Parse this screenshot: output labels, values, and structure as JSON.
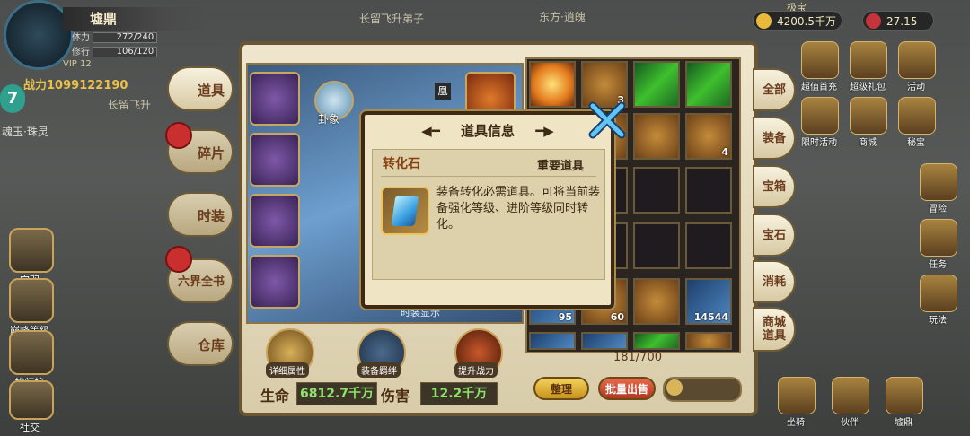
{
  "player": {
    "name": "墟鼎",
    "stat1_label": "体力",
    "stat1_value": "272/240",
    "stat2_label": "修行",
    "stat2_value": "106/120",
    "vip": "VIP 12",
    "power_label": "战力",
    "power_value": "1099122190",
    "badge": "7"
  },
  "resources": {
    "gold": "4200.5千万",
    "gems": "27.15"
  },
  "left_menu": [
    {
      "label": "宫羽"
    },
    {
      "label": "巅峰等级"
    },
    {
      "label": "排行榜"
    },
    {
      "label": "社交"
    }
  ],
  "background_text": {
    "top_center_1": "长留飞升弟子",
    "top_center_2": "东方·逍魄",
    "left_place": "长留飞升",
    "left_sub": "魂玉·珠灵",
    "right_top": "极宝"
  },
  "bag_tabs": [
    {
      "label": "道具"
    },
    {
      "label": "碎片"
    },
    {
      "label": "时装"
    },
    {
      "label": "六界全书"
    },
    {
      "label": "仓库"
    }
  ],
  "character": {
    "gua_label": "卦象",
    "fashion_text": "时装显示",
    "phoenix_label": "凰"
  },
  "bottom_buttons": [
    {
      "label": "详细属性"
    },
    {
      "label": "装备羁绊"
    },
    {
      "label": "提升战力"
    }
  ],
  "stats": {
    "hp_label": "生命",
    "hp_value": "6812.7千万",
    "atk_label": "伤害",
    "atk_value": "12.2千万"
  },
  "bag": {
    "counts": {
      "slot1": "3",
      "slot2": "4",
      "slot3": "95",
      "slot4": "60",
      "slot5": "14544"
    },
    "capacity": "181/700",
    "sort_button": "整理",
    "sell_button": "批量出售"
  },
  "categories": [
    {
      "label": "全部"
    },
    {
      "label": "装备"
    },
    {
      "label": "宝箱"
    },
    {
      "label": "宝石"
    },
    {
      "label": "消耗"
    },
    {
      "label": "商城道具"
    }
  ],
  "right_icons": [
    {
      "label": "超值首充"
    },
    {
      "label": "超级礼包"
    },
    {
      "label": "活动"
    },
    {
      "label": "限时活动"
    },
    {
      "label": "商城"
    },
    {
      "label": "秘宝"
    },
    {
      "label": "冒险"
    },
    {
      "label": "任务"
    },
    {
      "label": "玩法"
    },
    {
      "label": "坐骑"
    },
    {
      "label": "伙伴"
    },
    {
      "label": "墟鼎"
    }
  ],
  "popup": {
    "title": "道具信息",
    "item_name": "转化石",
    "item_type": "重要道具",
    "description": "装备转化必需道具。可将当前装备强化等级、进阶等级同时转化。"
  },
  "colors": {
    "panel_border": "#6a5633",
    "popup_bg": "#efe4c3",
    "item_name": "#8a3f12",
    "hp_value": "#8de36b"
  }
}
